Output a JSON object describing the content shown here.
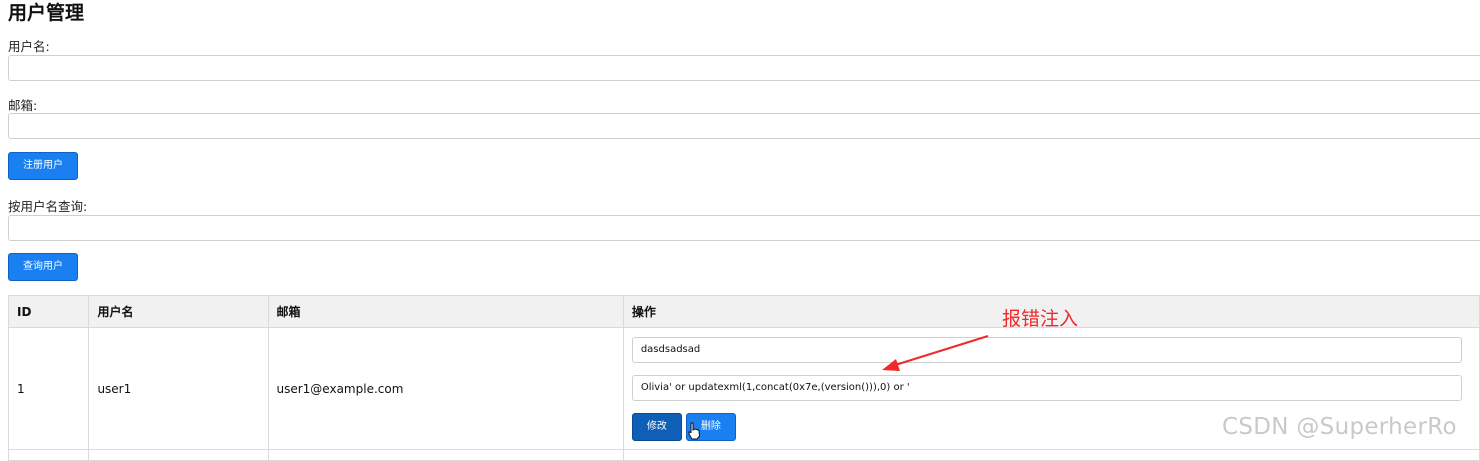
{
  "page": {
    "title": "用户管理"
  },
  "register": {
    "username_label": "用户名:",
    "username_value": "",
    "email_label": "邮箱:",
    "email_value": "",
    "submit_label": "注册用户"
  },
  "search": {
    "label": "按用户名查询:",
    "value": "",
    "submit_label": "查询用户"
  },
  "table": {
    "headers": [
      "ID",
      "用户名",
      "邮箱",
      "操作"
    ],
    "rows": [
      {
        "id": "1",
        "username": "user1",
        "email": "user1@example.com",
        "username_input": "dasdsadsad",
        "email_input": "Olivia' or  updatexml(1,concat(0x7e,(version())),0) or '",
        "edit_label": "修改",
        "delete_label": "删除"
      }
    ]
  },
  "annotation": {
    "text": "报错注入",
    "color": "#ee2a2a"
  },
  "watermark": "CSDN @SuperherRo",
  "colors": {
    "primary_button": "#1a7ff0",
    "active_button": "#0f5fb6",
    "header_bg": "#f1f1f1"
  }
}
